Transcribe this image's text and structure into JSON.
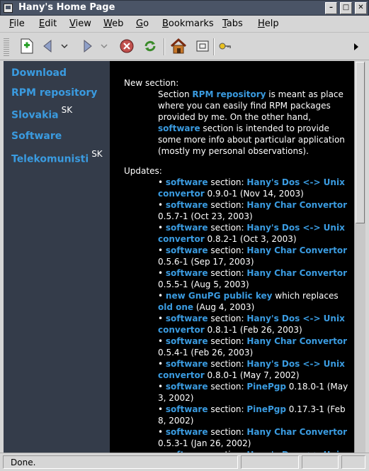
{
  "window": {
    "title": "Hany's Home Page"
  },
  "menu": [
    "File",
    "Edit",
    "View",
    "Web",
    "Go",
    "Bookmarks",
    "Tabs",
    "Help"
  ],
  "toolbar": {
    "new_tab": "new-tab-icon",
    "back": "back-arrow-icon",
    "forward": "forward-arrow-icon",
    "stop": "stop-icon",
    "reload": "reload-icon",
    "home": "home-icon",
    "fullscreen": "fullscreen-icon",
    "extra": "key-icon"
  },
  "sidebar": {
    "items": [
      {
        "label": "Download",
        "sup": ""
      },
      {
        "label": "RPM repository",
        "sup": ""
      },
      {
        "label": "Slovakia",
        "sup": "SK"
      },
      {
        "label": "Software",
        "sup": ""
      },
      {
        "label": "Telekomunisti",
        "sup": "SK"
      }
    ]
  },
  "content": {
    "lines": [
      {
        "indent": 20,
        "parts": [
          [
            "New section:",
            "t"
          ]
        ]
      },
      {
        "indent": 68,
        "parts": [
          [
            "Section ",
            "t"
          ],
          [
            "RPM repository",
            "l"
          ],
          [
            " is meant as place",
            "t"
          ]
        ]
      },
      {
        "indent": 68,
        "parts": [
          [
            "where you can easily find RPM packages",
            "t"
          ]
        ]
      },
      {
        "indent": 68,
        "parts": [
          [
            "provided by me. On the other hand,",
            "t"
          ]
        ]
      },
      {
        "indent": 68,
        "parts": [
          [
            "software",
            "l"
          ],
          [
            " section is intended to provide",
            "t"
          ]
        ]
      },
      {
        "indent": 68,
        "parts": [
          [
            "some more info about particular application",
            "t"
          ]
        ]
      },
      {
        "indent": 68,
        "parts": [
          [
            "(mostly my personal observations).",
            "t"
          ]
        ]
      },
      {
        "indent": 20,
        "gap": 1,
        "parts": [
          [
            "Updates:",
            "t"
          ]
        ]
      },
      {
        "indent": 68,
        "parts": [
          [
            "• ",
            "t"
          ],
          [
            "software",
            "l"
          ],
          [
            " section: ",
            "t"
          ],
          [
            "Hany's Dos <-> Unix",
            "l"
          ]
        ]
      },
      {
        "indent": 68,
        "parts": [
          [
            "convertor",
            "l"
          ],
          [
            " 0.9.0-1 (Nov 14, 2003)",
            "t"
          ]
        ]
      },
      {
        "indent": 68,
        "parts": [
          [
            "• ",
            "t"
          ],
          [
            "software",
            "l"
          ],
          [
            " section: ",
            "t"
          ],
          [
            "Hany Char Convertor",
            "l"
          ]
        ]
      },
      {
        "indent": 68,
        "parts": [
          [
            "0.5.7-1 (Oct 23, 2003)",
            "t"
          ]
        ]
      },
      {
        "indent": 68,
        "parts": [
          [
            "• ",
            "t"
          ],
          [
            "software",
            "l"
          ],
          [
            " section: ",
            "t"
          ],
          [
            "Hany's Dos <-> Unix",
            "l"
          ]
        ]
      },
      {
        "indent": 68,
        "parts": [
          [
            "convertor",
            "l"
          ],
          [
            " 0.8.2-1 (Oct 3, 2003)",
            "t"
          ]
        ]
      },
      {
        "indent": 68,
        "parts": [
          [
            "• ",
            "t"
          ],
          [
            "software",
            "l"
          ],
          [
            " section: ",
            "t"
          ],
          [
            "Hany Char Convertor",
            "l"
          ]
        ]
      },
      {
        "indent": 68,
        "parts": [
          [
            "0.5.6-1 (Sep 17, 2003)",
            "t"
          ]
        ]
      },
      {
        "indent": 68,
        "parts": [
          [
            "• ",
            "t"
          ],
          [
            "software",
            "l"
          ],
          [
            " section: ",
            "t"
          ],
          [
            "Hany Char Convertor",
            "l"
          ]
        ]
      },
      {
        "indent": 68,
        "parts": [
          [
            "0.5.5-1 (Aug 5, 2003)",
            "t"
          ]
        ]
      },
      {
        "indent": 68,
        "parts": [
          [
            "• ",
            "t"
          ],
          [
            "new GnuPG public key",
            "l"
          ],
          [
            " which replaces",
            "t"
          ]
        ]
      },
      {
        "indent": 68,
        "parts": [
          [
            "old one",
            "l"
          ],
          [
            " (Aug 4, 2003)",
            "t"
          ]
        ]
      },
      {
        "indent": 68,
        "parts": [
          [
            "• ",
            "t"
          ],
          [
            "software",
            "l"
          ],
          [
            " section: ",
            "t"
          ],
          [
            "Hany's Dos <-> Unix",
            "l"
          ]
        ]
      },
      {
        "indent": 68,
        "parts": [
          [
            "convertor",
            "l"
          ],
          [
            " 0.8.1-1 (Feb 26, 2003)",
            "t"
          ]
        ]
      },
      {
        "indent": 68,
        "parts": [
          [
            "• ",
            "t"
          ],
          [
            "software",
            "l"
          ],
          [
            " section: ",
            "t"
          ],
          [
            "Hany Char Convertor",
            "l"
          ]
        ]
      },
      {
        "indent": 68,
        "parts": [
          [
            "0.5.4-1 (Feb 26, 2003)",
            "t"
          ]
        ]
      },
      {
        "indent": 68,
        "parts": [
          [
            "• ",
            "t"
          ],
          [
            "software",
            "l"
          ],
          [
            " section: ",
            "t"
          ],
          [
            "Hany's Dos <-> Unix",
            "l"
          ]
        ]
      },
      {
        "indent": 68,
        "parts": [
          [
            "convertor",
            "l"
          ],
          [
            " 0.8.0-1 (May 7, 2002)",
            "t"
          ]
        ]
      },
      {
        "indent": 68,
        "parts": [
          [
            "• ",
            "t"
          ],
          [
            "software",
            "l"
          ],
          [
            " section: ",
            "t"
          ],
          [
            "PinePgp",
            "l"
          ],
          [
            " 0.18.0-1 (May",
            "t"
          ]
        ]
      },
      {
        "indent": 68,
        "parts": [
          [
            "3, 2002)",
            "t"
          ]
        ]
      },
      {
        "indent": 68,
        "parts": [
          [
            "• ",
            "t"
          ],
          [
            "software",
            "l"
          ],
          [
            " section: ",
            "t"
          ],
          [
            "PinePgp",
            "l"
          ],
          [
            " 0.17.3-1 (Feb",
            "t"
          ]
        ]
      },
      {
        "indent": 68,
        "parts": [
          [
            "8, 2002)",
            "t"
          ]
        ]
      },
      {
        "indent": 68,
        "parts": [
          [
            "• ",
            "t"
          ],
          [
            "software",
            "l"
          ],
          [
            " section: ",
            "t"
          ],
          [
            "Hany Char Convertor",
            "l"
          ]
        ]
      },
      {
        "indent": 68,
        "parts": [
          [
            "0.5.3-1 (Jan 26, 2002)",
            "t"
          ]
        ]
      },
      {
        "indent": 68,
        "parts": [
          [
            "• ",
            "t"
          ],
          [
            "software",
            "l"
          ],
          [
            " section: ",
            "t"
          ],
          [
            "Hany's Dos <-> Unix",
            "l"
          ]
        ]
      }
    ]
  },
  "status": {
    "text": "Done."
  },
  "colors": {
    "link": "#3a9be0",
    "sidebar_bg": "#343c4a",
    "content_bg": "#000000",
    "chrome": "#d6d6d6"
  }
}
